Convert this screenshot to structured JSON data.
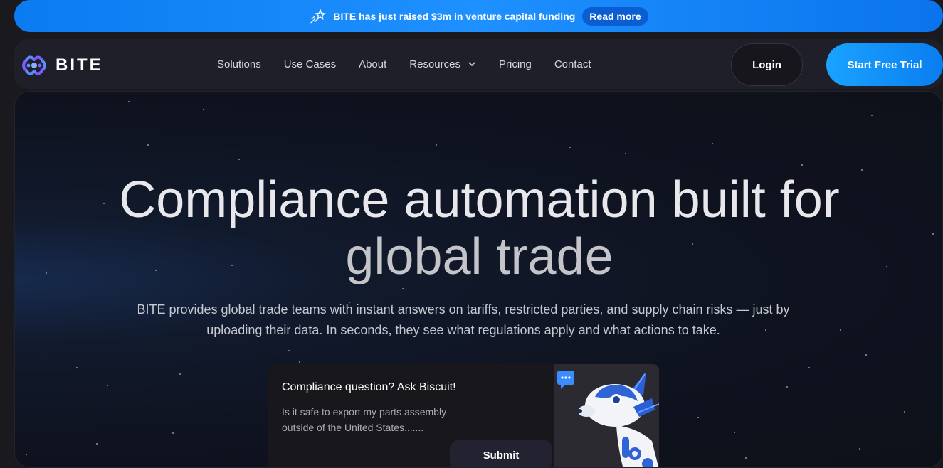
{
  "announcement": {
    "message": "BITE has just raised $3m in venture capital funding",
    "cta": "Read more",
    "icon": "shooting-star-icon"
  },
  "nav": {
    "brand": "BITE",
    "links": [
      "Solutions",
      "Use Cases",
      "About",
      "Resources",
      "Pricing",
      "Contact"
    ],
    "login": "Login",
    "trial": "Start Free Trial"
  },
  "hero": {
    "headline_line1": "Compliance automation built for",
    "headline_line2": "global trade",
    "subtext": "BITE provides global trade teams with instant answers on tariffs, restricted parties, and supply chain risks — just by uploading their data. In seconds, they see what regulations apply and what actions to take."
  },
  "chat": {
    "title": "Compliance question? Ask Biscuit!",
    "placeholder": "Is it safe to export my parts assembly outside of the United States.......",
    "submit": "Submit",
    "mascot_icon": "robot-dog-icon",
    "bubble_icon": "chat-bubble-icon"
  },
  "colors": {
    "accent": "#1e90ff",
    "background": "#1a1a1e"
  }
}
